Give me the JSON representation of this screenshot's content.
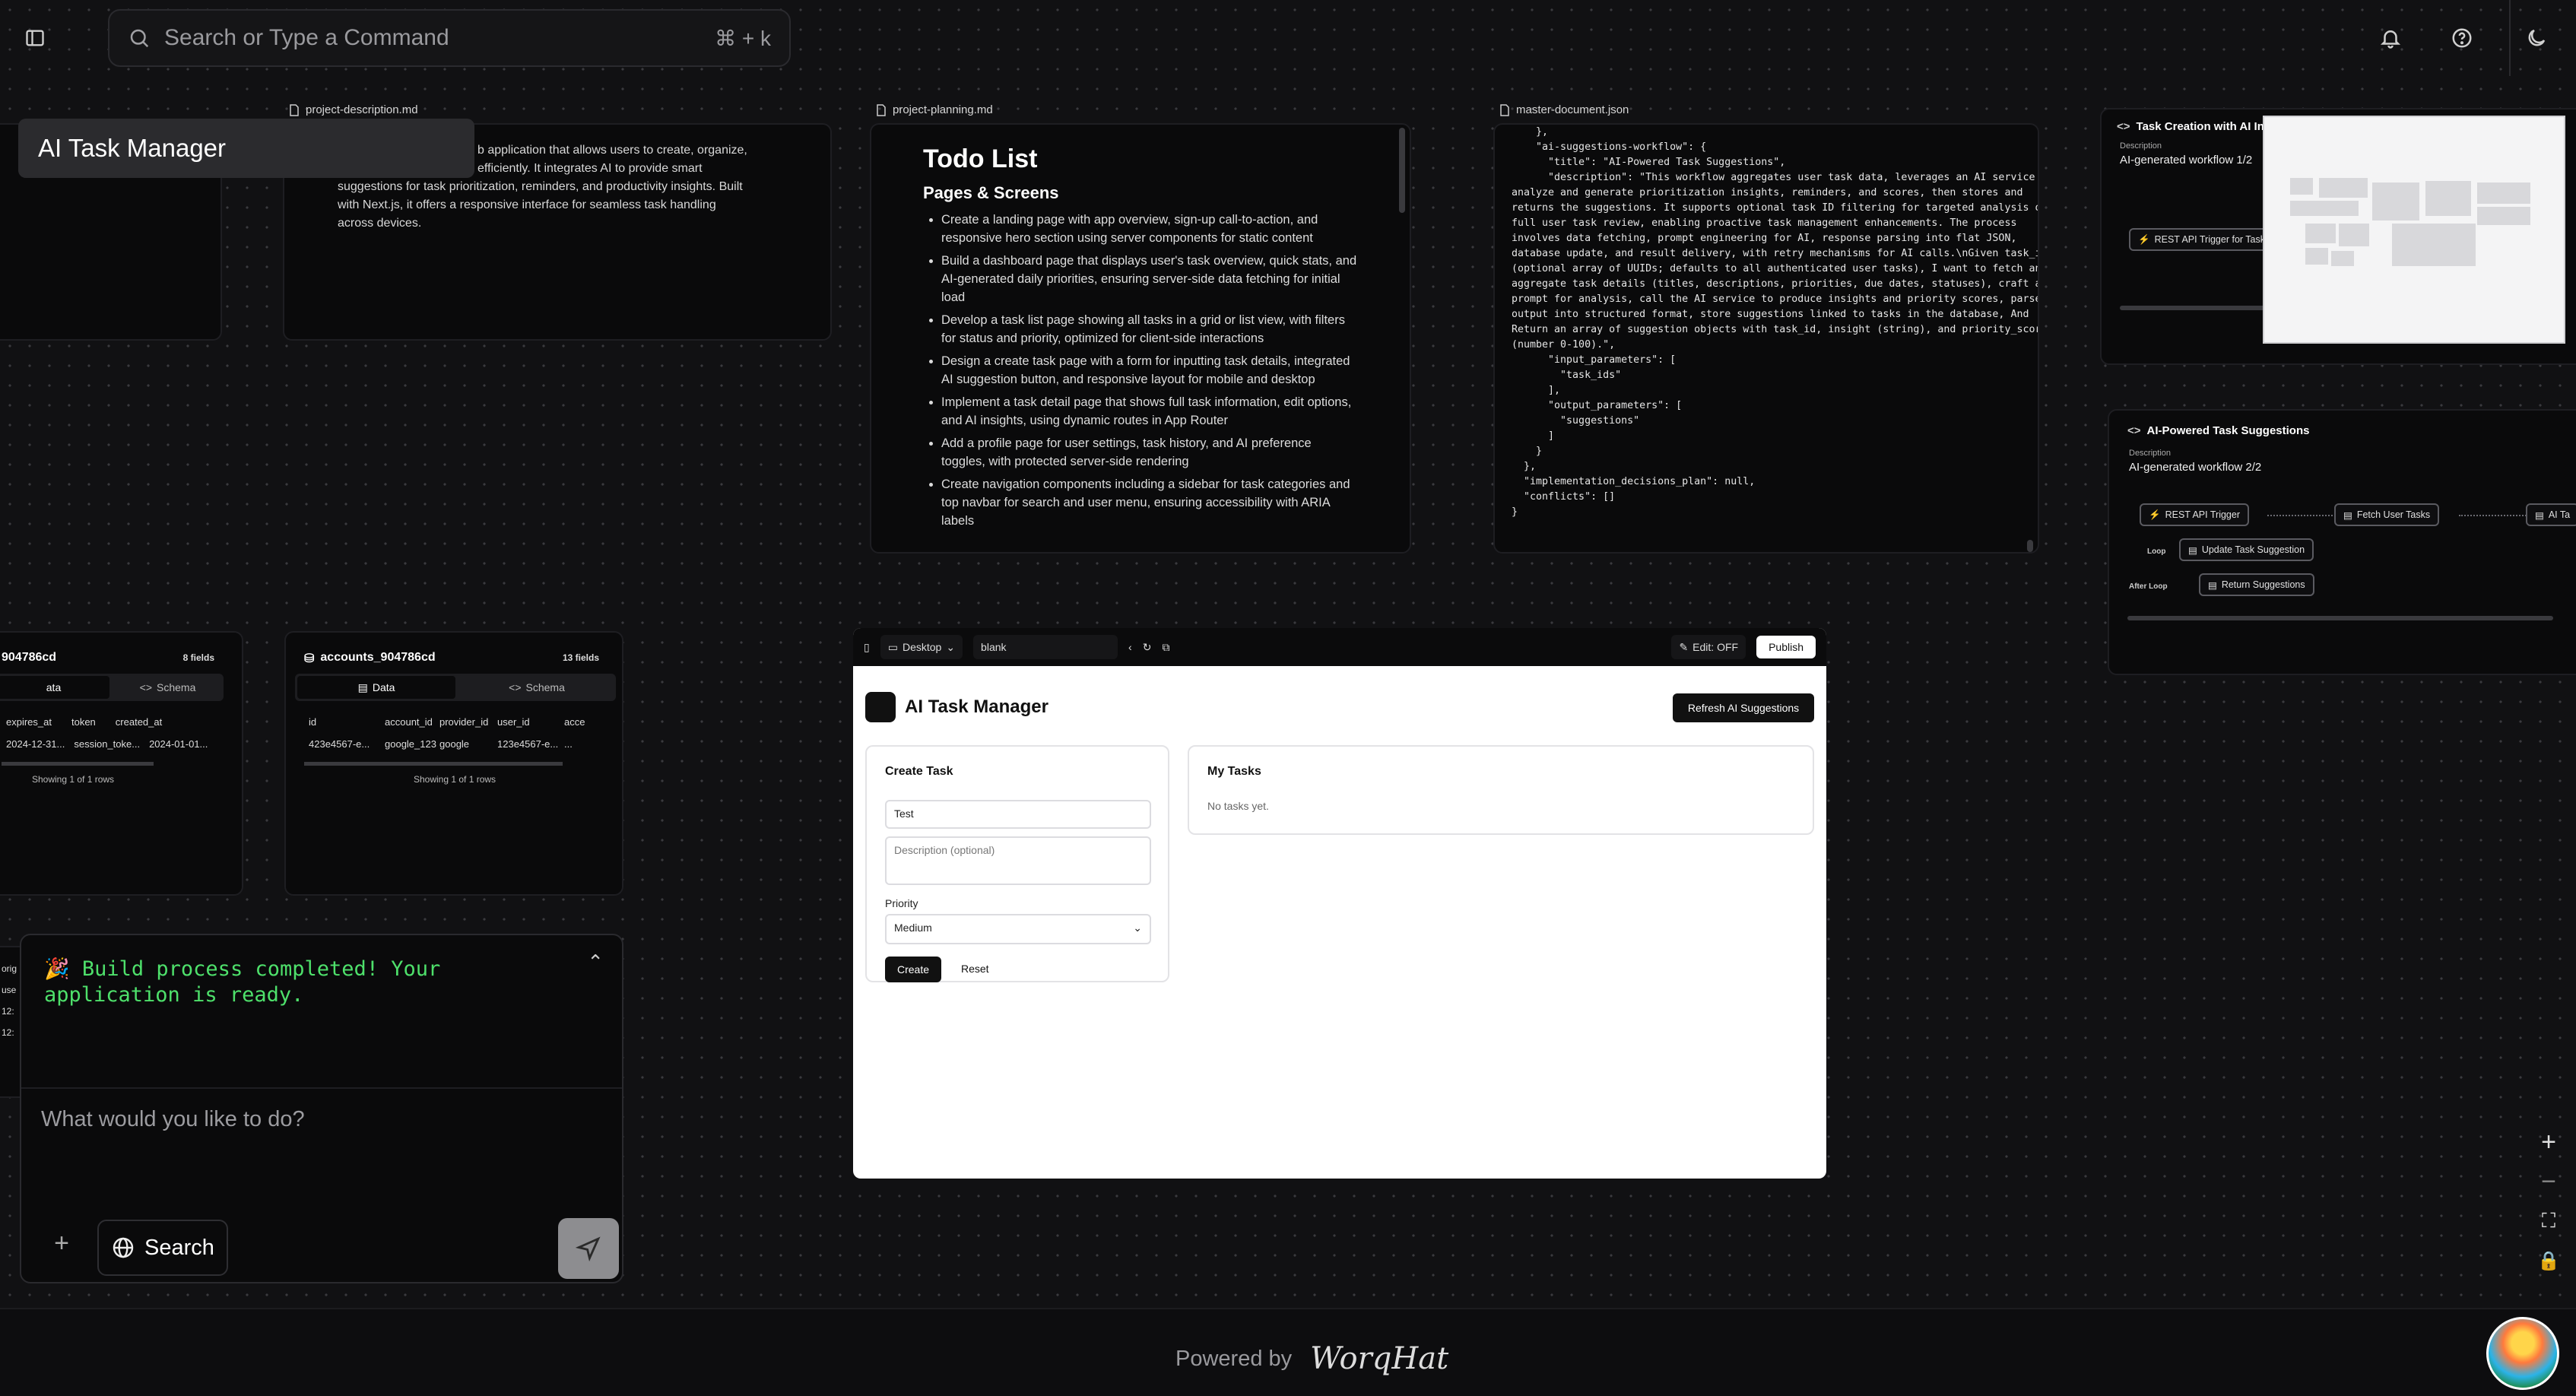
{
  "topbar": {
    "search_placeholder": "Search or Type a Command",
    "shortcut": "⌘ + k"
  },
  "project_title": "AI Task Manager",
  "description_card": {
    "filename": "project-description.md",
    "line1": "b application that allows users to create, organize,",
    "line2": "efficiently. It integrates AI to provide smart",
    "line3": "suggestions for task prioritization, reminders, and productivity insights. Built",
    "line4": "with Next.js, it offers a responsive interface for seamless task handling",
    "line5": "across devices."
  },
  "planning_card": {
    "filename": "project-planning.md",
    "title": "Todo List",
    "subtitle": "Pages & Screens",
    "items": [
      "Create a landing page with app overview, sign-up call-to-action, and responsive hero section using server components for static content",
      "Build a dashboard page that displays user's task overview, quick stats, and AI-generated daily priorities, ensuring server-side data fetching for initial load",
      "Develop a task list page showing all tasks in a grid or list view, with filters for status and priority, optimized for client-side interactions",
      "Design a create task page with a form for inputting task details, integrated AI suggestion button, and responsive layout for mobile and desktop",
      "Implement a task detail page that shows full task information, edit options, and AI insights, using dynamic routes in App Router",
      "Add a profile page for user settings, task history, and AI preference toggles, with protected server-side rendering",
      "Create navigation components including a sidebar for task categories and top navbar for search and user menu, ensuring accessibility with ARIA labels"
    ]
  },
  "master_card": {
    "filename": "master-document.json",
    "json_lines": [
      "    },",
      "    \"ai-suggestions-workflow\": {",
      "      \"title\": \"AI-Powered Task Suggestions\",",
      "      \"description\": \"This workflow aggregates user task data, leverages an AI service to",
      "analyze and generate prioritization insights, reminders, and scores, then stores and",
      "returns the suggestions. It supports optional task ID filtering for targeted analysis or",
      "full user task review, enabling proactive task management enhancements. The process",
      "involves data fetching, prompt engineering for AI, response parsing into flat JSON,",
      "database update, and result delivery, with retry mechanisms for AI calls.\\nGiven task_ids",
      "(optional array of UUIDs; defaults to all authenticated user tasks), I want to fetch and",
      "aggregate task details (titles, descriptions, priorities, due dates, statuses), craft an AI",
      "prompt for analysis, call the AI service to produce insights and priority scores, parse the",
      "output into structured format, store suggestions linked to tasks in the database, And",
      "Return an array of suggestion objects with task_id, insight (string), and priority_score",
      "(number 0-100).\",",
      "      \"input_parameters\": [",
      "        \"task_ids\"",
      "      ],",
      "      \"output_parameters\": [",
      "        \"suggestions\"",
      "      ]",
      "    }",
      "  },",
      "  \"implementation_decisions_plan\": null,",
      "  \"conflicts\": []",
      "}"
    ]
  },
  "workflow1": {
    "title": "Task Creation with AI In",
    "desc_label": "Description",
    "desc": "AI-generated workflow 1/2",
    "node": "REST API Trigger for Task"
  },
  "workflow2": {
    "title": "AI-Powered Task Suggestions",
    "desc_label": "Description",
    "desc": "AI-generated workflow 2/2",
    "nodes": [
      "REST API Trigger",
      "Fetch User Tasks",
      "AI Ta",
      "Update Task Suggestion",
      "Return Suggestions"
    ],
    "loop_label": "Loop",
    "after_loop_label": "After Loop"
  },
  "sessions_table": {
    "name": "904786cd",
    "fields": "8 fields",
    "tab_data": "ata",
    "tab_schema": "Schema",
    "columns": [
      "expires_at",
      "token",
      "created_at"
    ],
    "row": [
      "2024-12-31...",
      "session_toke...",
      "2024-01-01..."
    ],
    "footer": "Showing 1 of 1 rows"
  },
  "accounts_table": {
    "name": "accounts_904786cd",
    "fields": "13 fields",
    "tab_data": "Data",
    "tab_schema": "Schema",
    "columns": [
      "id",
      "account_id",
      "provider_id",
      "user_id",
      "acce"
    ],
    "row": [
      "423e4567-e...",
      "google_123",
      "google",
      "123e4567-e...",
      "..."
    ],
    "footer": "Showing 1 of 1 rows"
  },
  "preview": {
    "device": "Desktop",
    "route": "blank",
    "edit_label": "Edit: OFF",
    "publish_label": "Publish",
    "app_title": "AI Task Manager",
    "refresh_button": "Refresh AI Suggestions",
    "create_title": "Create Task",
    "title_value": "Test",
    "desc_placeholder": "Description (optional)",
    "priority_label": "Priority",
    "priority_value": "Medium",
    "create_button": "Create",
    "reset_button": "Reset",
    "my_tasks_title": "My Tasks",
    "no_tasks": "No tasks yet."
  },
  "chat": {
    "message": "🎉 Build process completed! Your application is ready.",
    "input_placeholder": "What would you like to do?",
    "search_label": "Search"
  },
  "footer": {
    "powered_by": "Powered by",
    "brand": "WorqHat"
  },
  "side_partial": {
    "l1": "orig",
    "l2": "use",
    "l3": "12:",
    "l4": "12:"
  }
}
